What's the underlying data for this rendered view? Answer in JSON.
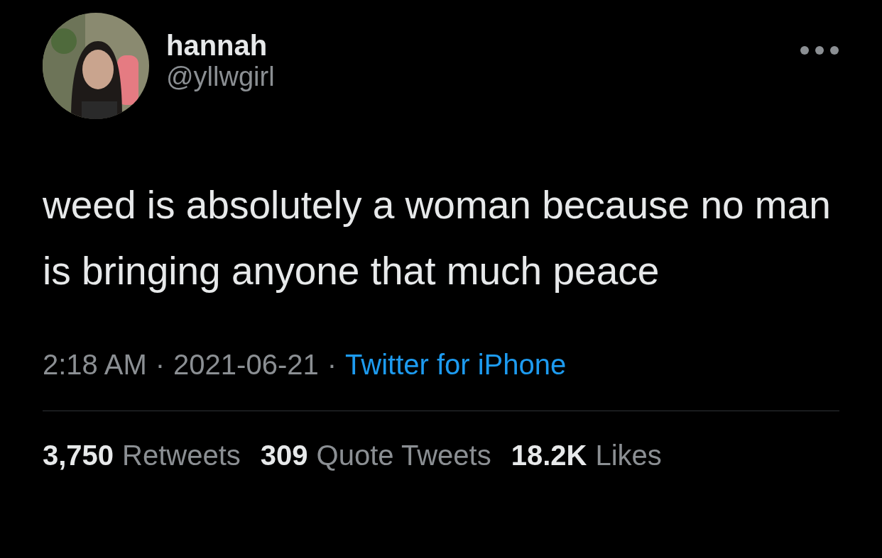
{
  "author": {
    "name": "hannah",
    "handle": "@yllwgirl"
  },
  "tweet": {
    "text": "weed is absolutely a woman because no man is bringing anyone that much peace"
  },
  "meta": {
    "time": "2:18 AM",
    "separator_1": "·",
    "date": "2021-06-21",
    "separator_2": "·",
    "source": "Twitter for iPhone"
  },
  "stats": [
    {
      "count": "3,750",
      "label": "Retweets"
    },
    {
      "count": "309",
      "label": "Quote Tweets"
    },
    {
      "count": "18.2K",
      "label": "Likes"
    }
  ]
}
